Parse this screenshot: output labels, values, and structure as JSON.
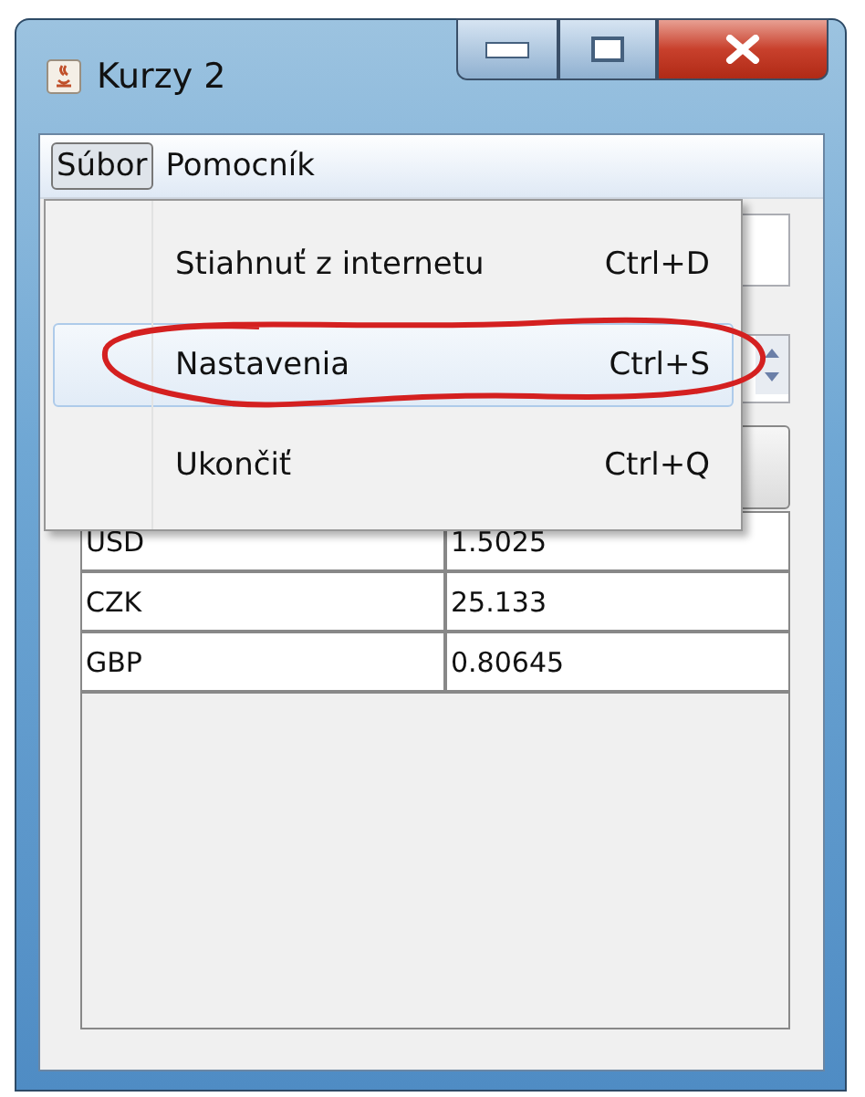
{
  "window": {
    "title": "Kurzy 2"
  },
  "menubar": [
    {
      "label": "Súbor",
      "selected": true
    },
    {
      "label": "Pomocník",
      "selected": false
    }
  ],
  "menu": [
    {
      "label": "Stiahnuť z internetu",
      "shortcut": "Ctrl+D",
      "selected": false
    },
    {
      "label": "Nastavenia",
      "shortcut": "Ctrl+S",
      "selected": true
    },
    {
      "label": "Ukončiť",
      "shortcut": "Ctrl+Q",
      "selected": false
    }
  ],
  "table": {
    "rows": [
      [
        "USD",
        "1.5025"
      ],
      [
        "CZK",
        "25.133"
      ],
      [
        "GBP",
        "0.80645"
      ]
    ]
  }
}
